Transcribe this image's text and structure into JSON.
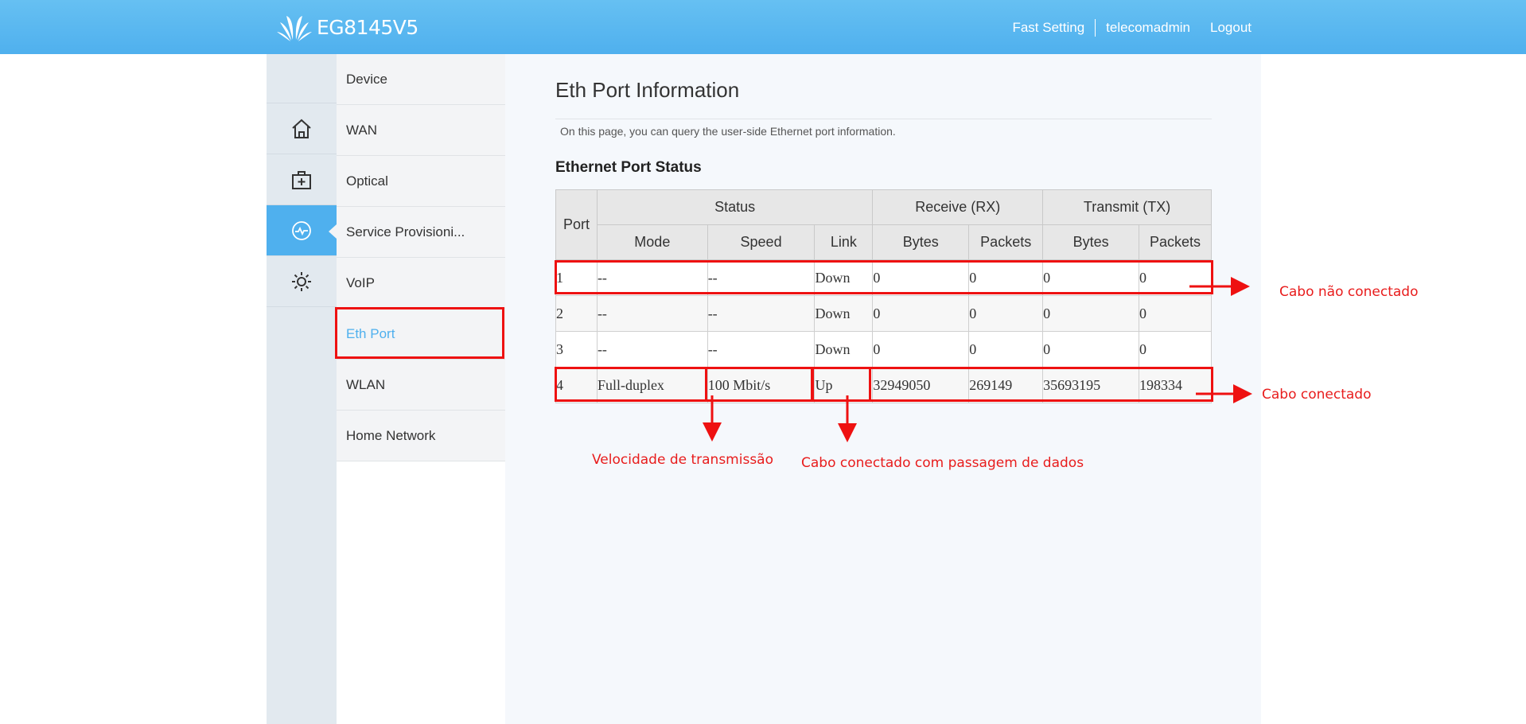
{
  "header": {
    "product": "EG8145V5",
    "links": {
      "fast_setting": "Fast Setting",
      "user": "telecomadmin",
      "logout": "Logout"
    },
    "accent_color": "#4fb0ee"
  },
  "icon_nav": [
    {
      "icon": "home-icon"
    },
    {
      "icon": "first-aid-kit-icon"
    },
    {
      "icon": "status-monitor-icon",
      "active": true
    },
    {
      "icon": "gear-icon"
    }
  ],
  "menu": {
    "items": [
      {
        "label": "Device"
      },
      {
        "label": "WAN"
      },
      {
        "label": "Optical"
      },
      {
        "label": "Service Provisioni..."
      },
      {
        "label": "VoIP"
      },
      {
        "label": "Eth Port",
        "active": true
      },
      {
        "label": "WLAN"
      },
      {
        "label": "Home Network"
      }
    ]
  },
  "page": {
    "title": "Eth Port Information",
    "description": "On this page, you can query the user-side Ethernet port information.",
    "section_title": "Ethernet Port Status"
  },
  "table": {
    "group_headers": {
      "port": "Port",
      "status": "Status",
      "rx": "Receive (RX)",
      "tx": "Transmit (TX)"
    },
    "sub_headers": [
      "Mode",
      "Speed",
      "Link",
      "Bytes",
      "Packets",
      "Bytes",
      "Packets"
    ],
    "rows": [
      [
        "1",
        "--",
        "--",
        "Down",
        "0",
        "0",
        "0",
        "0"
      ],
      [
        "2",
        "--",
        "--",
        "Down",
        "0",
        "0",
        "0",
        "0"
      ],
      [
        "3",
        "--",
        "--",
        "Down",
        "0",
        "0",
        "0",
        "0"
      ],
      [
        "4",
        "Full-duplex",
        "100 Mbit/s",
        "Up",
        "32949050",
        "269149",
        "35693195",
        "198334"
      ]
    ]
  },
  "annotations": {
    "not_connected": "Cabo não conectado",
    "connected": "Cabo conectado",
    "speed": "Velocidade de transmissão",
    "data_flow": "Cabo conectado com passagem de dados",
    "color": "#e81c1c"
  }
}
